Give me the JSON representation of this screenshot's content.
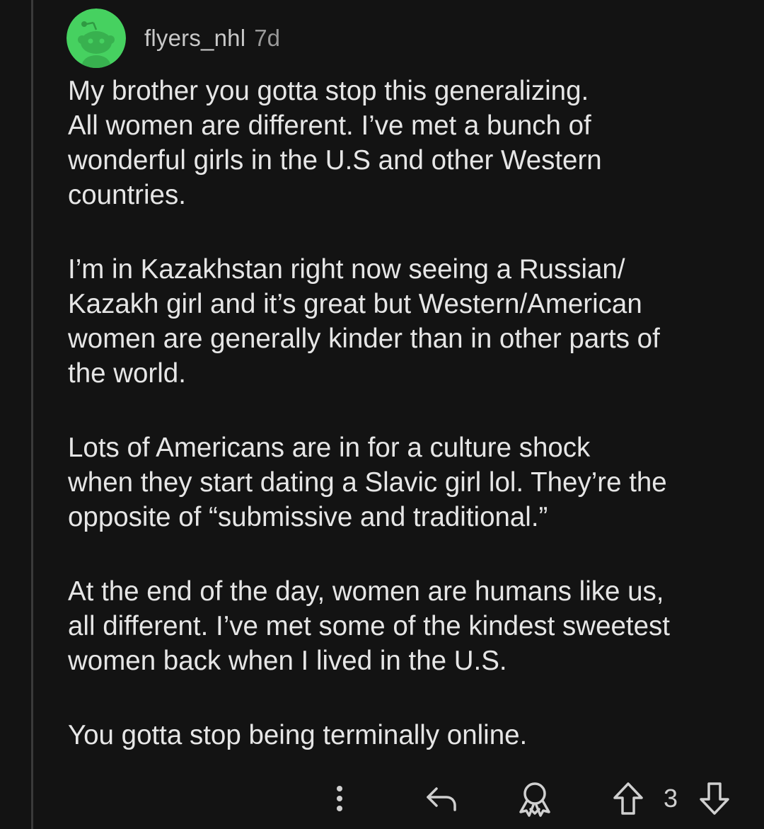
{
  "comment": {
    "username": "flyers_nhl",
    "age": "7d",
    "paragraphs": [
      "My brother you gotta stop this generalizing.\nAll women are different. I’ve met a bunch of\nwonderful girls in the U.S and other Western\ncountries.",
      "I’m in Kazakhstan right now seeing a Russian/\nKazakh girl and it’s great but Western/American\nwomen are generally kinder than in other parts of\nthe world.",
      "Lots of Americans are in for a culture shock\nwhen they start dating a Slavic girl lol. They’re the\nopposite of “submissive and traditional.”",
      "At the end of the day, women are humans like us,\nall different. I’ve met some of the kindest sweetest\nwomen back when I lived in the U.S.",
      "You gotta stop being terminally online."
    ],
    "vote_count": "3"
  },
  "icons": {
    "more": "more-vertical-icon",
    "reply": "reply-arrow-icon",
    "award": "award-icon",
    "upvote": "upvote-arrow-icon",
    "downvote": "downvote-arrow-icon",
    "avatar": "snoo-avatar-icon"
  },
  "colors": {
    "background": "#131313",
    "avatar_bg": "#46d160",
    "text": "#e6e6e6",
    "meta": "#9a9a9a"
  }
}
